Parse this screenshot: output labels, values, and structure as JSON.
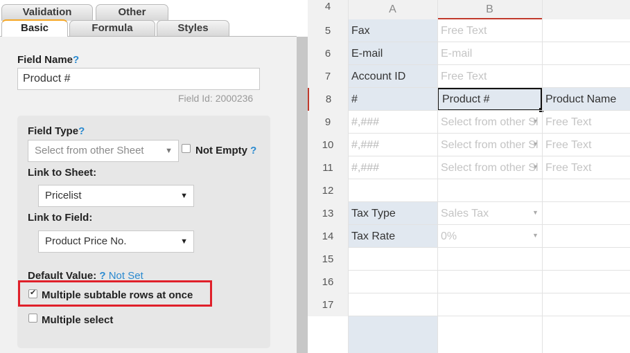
{
  "tabs": {
    "row1": [
      "Validation",
      "Other"
    ],
    "row2": [
      "Basic",
      "Formula",
      "Styles"
    ]
  },
  "field_name": {
    "label": "Field Name",
    "help": "?",
    "value": "Product #",
    "field_id": "Field Id: 2000236"
  },
  "field_type": {
    "label": "Field Type",
    "help": "?",
    "selected": "Select from other Sheet",
    "not_empty_label": "Not Empty",
    "not_empty_help": "?"
  },
  "link_to_sheet": {
    "label": "Link to Sheet:",
    "selected": "Pricelist"
  },
  "link_to_field": {
    "label": "Link to Field:",
    "selected": "Product Price No."
  },
  "default_value": {
    "label": "Default Value:",
    "help": "?",
    "link": "Not Set"
  },
  "multiple_subtable": {
    "label": "Multiple subtable rows at once",
    "checked": true
  },
  "multiple_select": {
    "label": "Multiple select",
    "checked": false
  },
  "sheet": {
    "columns": [
      "A",
      "B"
    ],
    "top_row_number": "4",
    "rows": [
      {
        "num": "5",
        "a": "Fax",
        "b": "Free Text",
        "c": ""
      },
      {
        "num": "6",
        "a": "E-mail",
        "b": "E-mail",
        "c": ""
      },
      {
        "num": "7",
        "a": "Account ID",
        "b": "Free Text",
        "c": ""
      },
      {
        "num": "8",
        "a": "#",
        "b": "Product #",
        "c": "Product Name"
      },
      {
        "num": "9",
        "a": "#,###",
        "b": "Select from other Sl",
        "c": "Free Text"
      },
      {
        "num": "10",
        "a": "#,###",
        "b": "Select from other Sl",
        "c": "Free Text"
      },
      {
        "num": "11",
        "a": "#,###",
        "b": "Select from other Sl",
        "c": "Free Text"
      },
      {
        "num": "12",
        "a": "",
        "b": "",
        "c": ""
      },
      {
        "num": "13",
        "a": "Tax Type",
        "b": "Sales Tax",
        "c": ""
      },
      {
        "num": "14",
        "a": "Tax Rate",
        "b": "0%",
        "c": ""
      },
      {
        "num": "15",
        "a": "",
        "b": "",
        "c": ""
      },
      {
        "num": "16",
        "a": "",
        "b": "",
        "c": ""
      },
      {
        "num": "17",
        "a": "",
        "b": "",
        "c": ""
      }
    ]
  },
  "colors": {
    "tab_active_accent": "#f5a623",
    "help_blue": "#2a8ad0",
    "highlight_red": "#e0202a",
    "label_cell_bg": "#e1e8f0"
  }
}
